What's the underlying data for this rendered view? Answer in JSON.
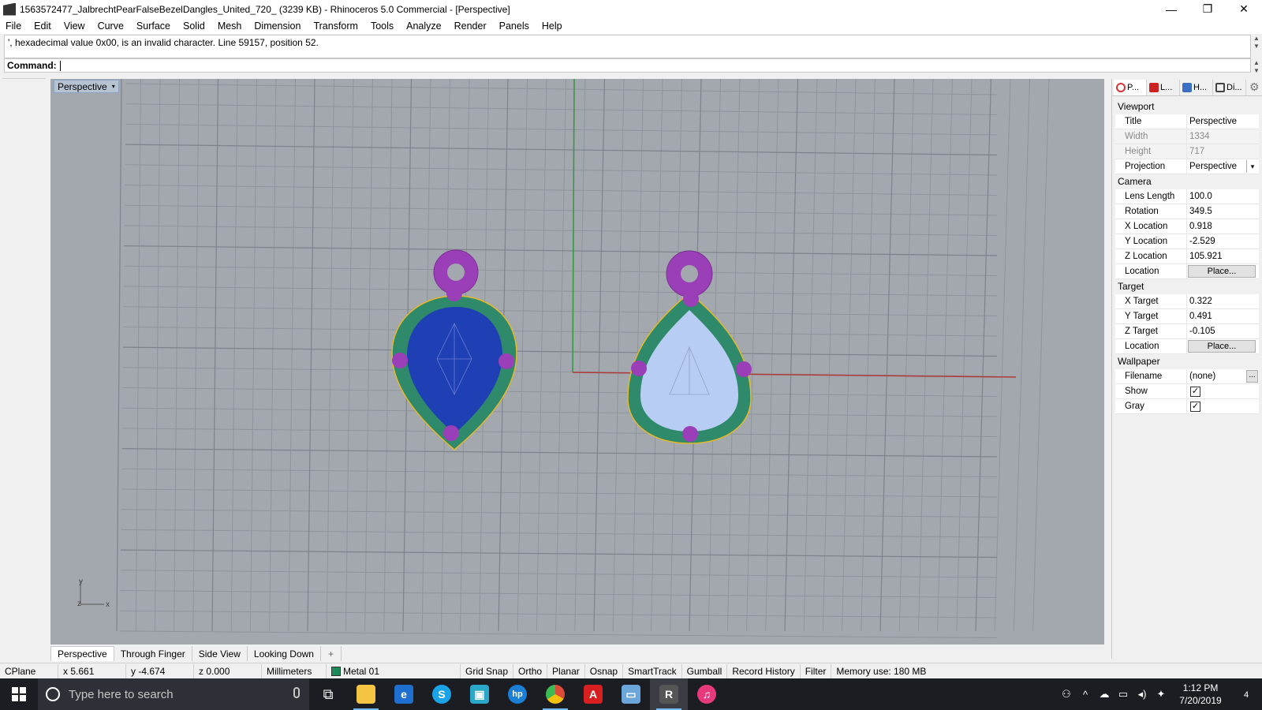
{
  "window": {
    "title": "1563572477_JalbrechtPearFalseBezelDangles_United_720_ (3239 KB) - Rhinoceros 5.0 Commercial - [Perspective]",
    "minimize": "—",
    "maximize": "❐",
    "close": "✕"
  },
  "menu": [
    "File",
    "Edit",
    "View",
    "Curve",
    "Surface",
    "Solid",
    "Mesh",
    "Dimension",
    "Transform",
    "Tools",
    "Analyze",
    "Render",
    "Panels",
    "Help"
  ],
  "command": {
    "history": "', hexadecimal value 0x00, is an invalid character. Line 59157, position 52.",
    "prompt_label": "Command:",
    "value": ""
  },
  "viewport": {
    "label": "Perspective",
    "dropdown_glyph": "▾",
    "axis_y": "y",
    "axis_z": "z",
    "axis_x": "x",
    "colors": {
      "background": "#a3a8ae",
      "grid": "#8e949b",
      "x_axis": "#b03a3a",
      "y_axis": "#2f9a3a",
      "bezel": "#2e8a6a",
      "prong": "#9b3fb8",
      "stone_left": "#1f3fb5",
      "stone_right": "#b8cdf3",
      "edge": "#e5b829"
    }
  },
  "view_tabs": [
    "Perspective",
    "Through Finger",
    "Side View",
    "Looking Down"
  ],
  "view_tab_add": "+",
  "status": {
    "cplane": "CPlane",
    "x": "x 5.661",
    "y": "y -4.674",
    "z": "z 0.000",
    "units": "Millimeters",
    "layer": "Metal 01",
    "toggles": [
      "Grid Snap",
      "Ortho",
      "Planar",
      "Osnap",
      "SmartTrack",
      "Gumball",
      "Record History",
      "Filter"
    ],
    "memory": "Memory use: 180 MB"
  },
  "panel": {
    "tabs": [
      {
        "label": "P...",
        "icon": "properties-icon",
        "color": "#d33"
      },
      {
        "label": "L...",
        "icon": "layers-icon",
        "color": "#c22"
      },
      {
        "label": "H...",
        "icon": "help-icon",
        "color": "#3a6fc4"
      },
      {
        "label": "Di...",
        "icon": "display-icon",
        "color": "#444"
      }
    ],
    "sections": {
      "viewport": "Viewport",
      "camera": "Camera",
      "target": "Target",
      "wallpaper": "Wallpaper"
    },
    "viewport_props": {
      "title_k": "Title",
      "title_v": "Perspective",
      "width_k": "Width",
      "width_v": "1334",
      "height_k": "Height",
      "height_v": "717",
      "projection_k": "Projection",
      "projection_v": "Perspective"
    },
    "camera_props": {
      "lens_k": "Lens Length",
      "lens_v": "100.0",
      "rotation_k": "Rotation",
      "rotation_v": "349.5",
      "xloc_k": "X Location",
      "xloc_v": "0.918",
      "yloc_k": "Y Location",
      "yloc_v": "-2.529",
      "zloc_k": "Z Location",
      "zloc_v": "105.921",
      "loc_k": "Location",
      "loc_btn": "Place..."
    },
    "target_props": {
      "xt_k": "X Target",
      "xt_v": "0.322",
      "yt_k": "Y Target",
      "yt_v": "0.491",
      "zt_k": "Z Target",
      "zt_v": "-0.105",
      "loc_k": "Location",
      "loc_btn": "Place..."
    },
    "wallpaper_props": {
      "file_k": "Filename",
      "file_v": "(none)",
      "file_btn": "...",
      "show_k": "Show",
      "show_checked": true,
      "gray_k": "Gray",
      "gray_checked": true
    }
  },
  "taskbar": {
    "search_placeholder": "Type here to search",
    "apps": [
      {
        "name": "task-view-icon",
        "glyph": "⧉",
        "color": "transparent"
      },
      {
        "name": "file-explorer-icon",
        "glyph": "",
        "color": "#f4c542"
      },
      {
        "name": "edge-icon",
        "glyph": "e",
        "color": "#1f6fd0"
      },
      {
        "name": "skype-icon",
        "glyph": "S",
        "color": "#1aa3e6"
      },
      {
        "name": "photo-app-icon",
        "glyph": "▣",
        "color": "#2aa7c9"
      },
      {
        "name": "hp-icon",
        "glyph": "hp",
        "color": "#1c7fd6"
      },
      {
        "name": "chrome-icon",
        "glyph": "◉",
        "color": "#dd4b39"
      },
      {
        "name": "acrobat-icon",
        "glyph": "A",
        "color": "#d71f1f"
      },
      {
        "name": "scanner-icon",
        "glyph": "▭",
        "color": "#6aa6d9"
      },
      {
        "name": "rhino-icon",
        "glyph": "R",
        "color": "#555"
      },
      {
        "name": "itunes-icon",
        "glyph": "♫",
        "color": "#e73a7c"
      }
    ],
    "time": "1:12 PM",
    "date": "7/20/2019",
    "notif_count": "4"
  }
}
